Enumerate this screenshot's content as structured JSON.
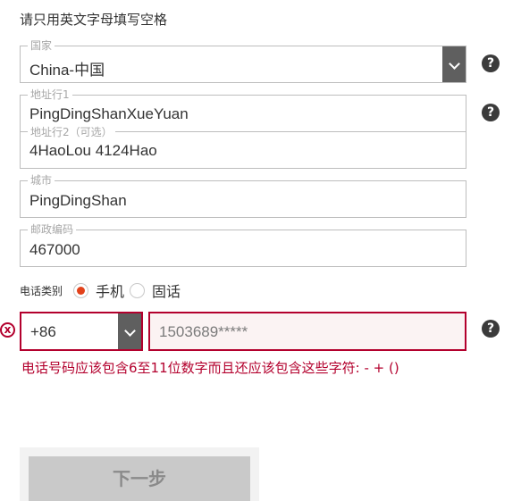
{
  "notice": "请只用英文字母填写空格",
  "country": {
    "label": "国家",
    "value": "China-中国"
  },
  "address": {
    "line1_label": "地址行1",
    "line1_value": "PingDingShanXueYuan",
    "line2_label": "地址行2（可选）",
    "line2_value": "4HaoLou 4124Hao"
  },
  "city": {
    "label": "城市",
    "value": "PingDingShan"
  },
  "postcode": {
    "label": "邮政编码",
    "value": "467000"
  },
  "phone_type": {
    "label": "电话类别",
    "options": [
      "手机",
      "固话"
    ],
    "selected": "手机"
  },
  "phone": {
    "country_code": "+86",
    "number": "1503689*****",
    "error": "电话号码应该包含6至11位数字而且还应该包含这些字符: - + ()"
  },
  "help_glyph": "?",
  "error_glyph": "x",
  "next_button": "下一步",
  "colors": {
    "error": "#b3002d",
    "radio_selected": "#e2421b",
    "select_button": "#5f5f5f"
  }
}
